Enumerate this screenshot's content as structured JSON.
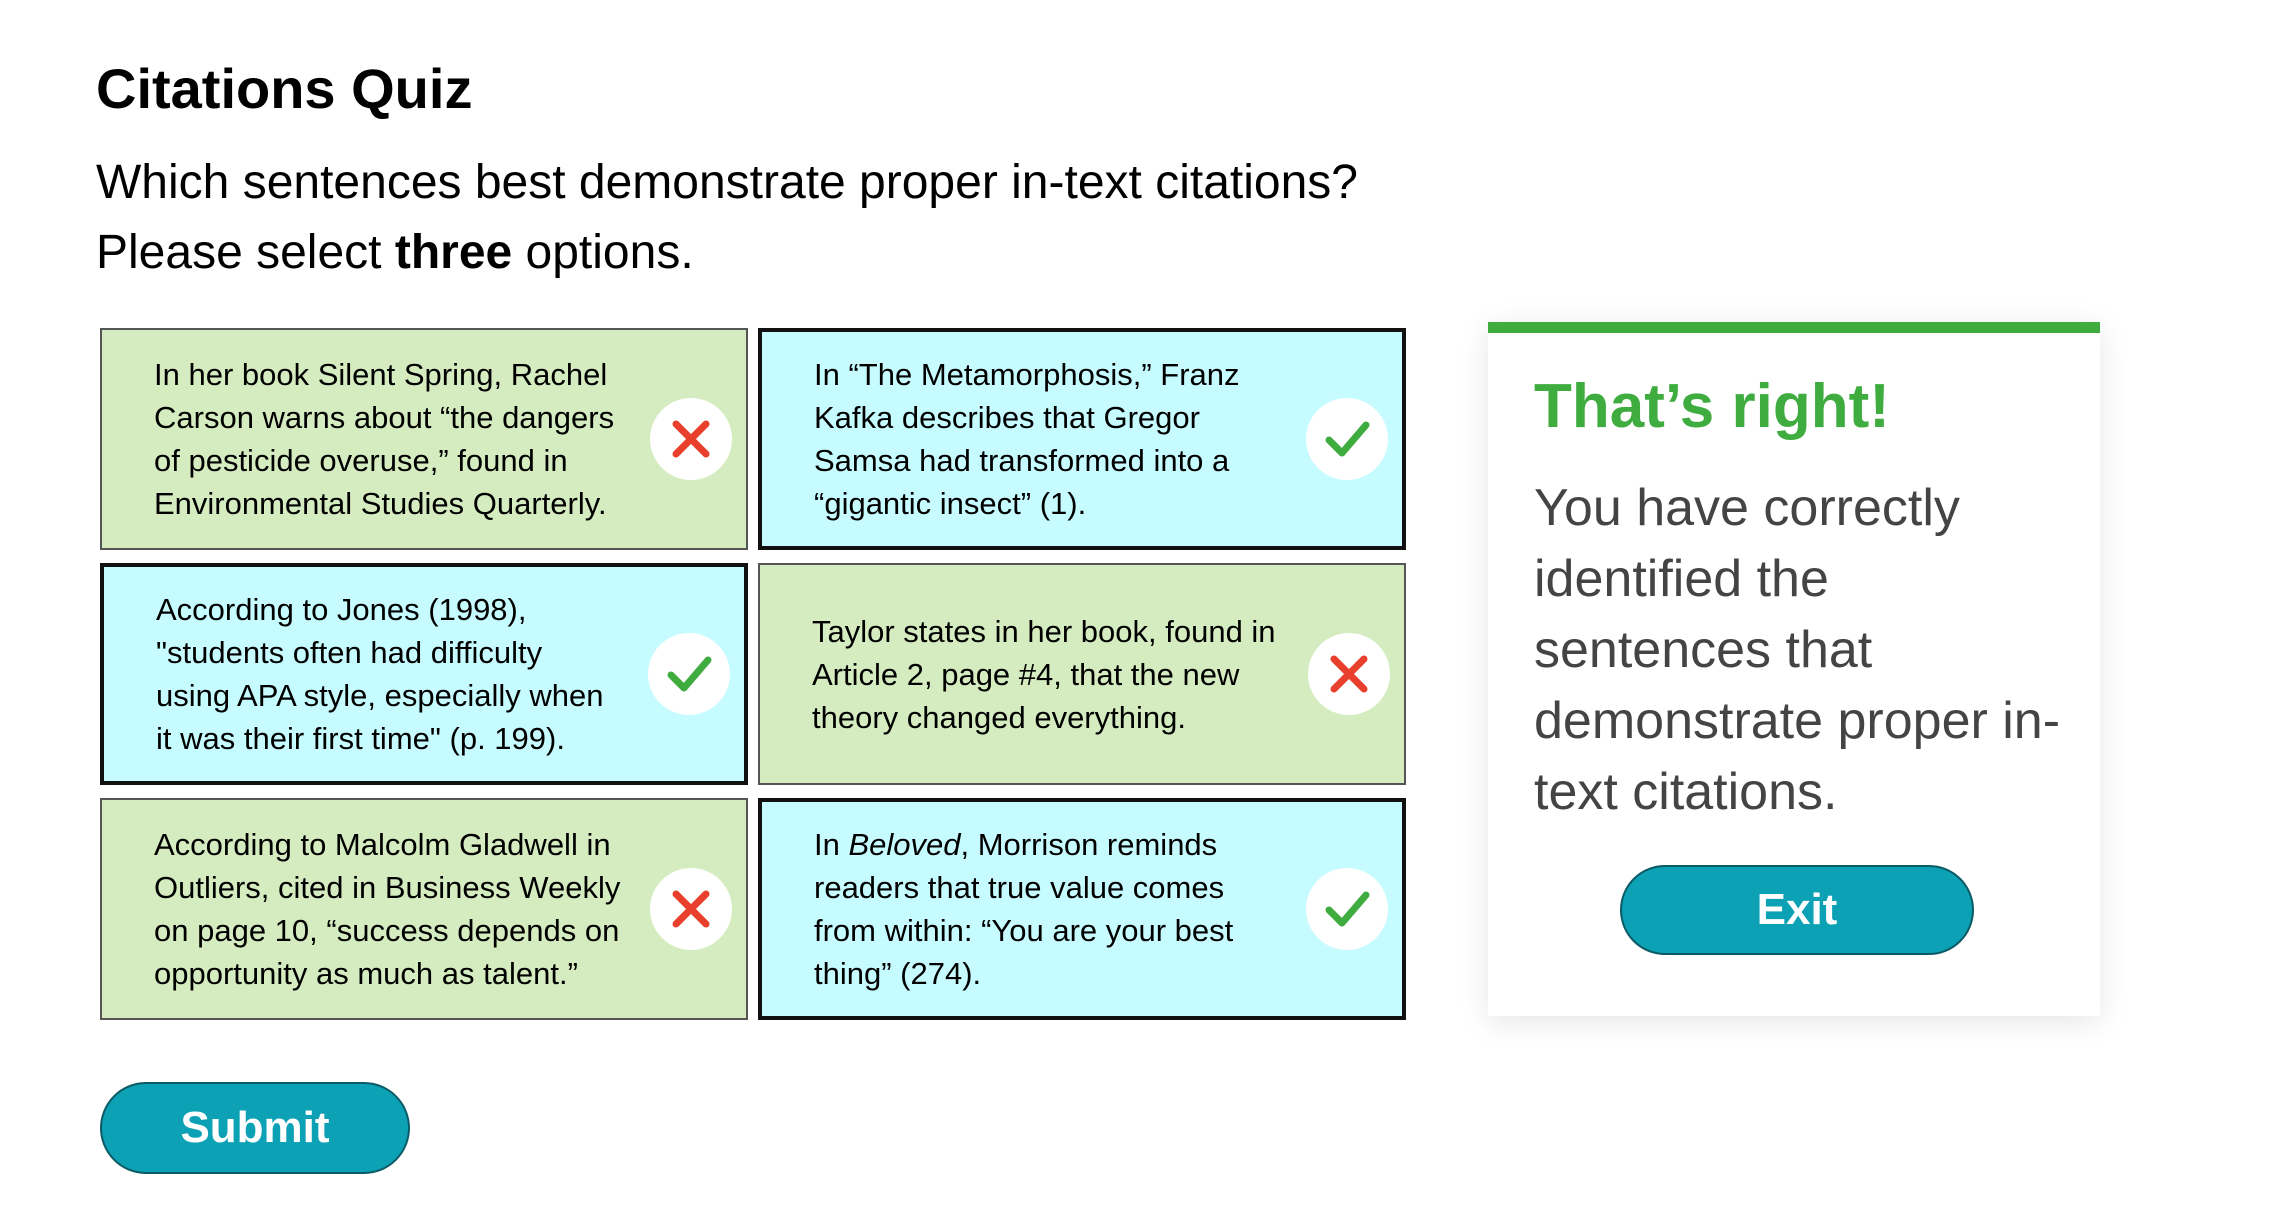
{
  "quiz": {
    "title": "Citations Quiz",
    "prompt_line1": "Which sentences best demonstrate proper in-text citations?",
    "prompt_line2_pre": "Please select ",
    "prompt_line2_bold": "three",
    "prompt_line2_post": " options."
  },
  "options": [
    {
      "text": "In her book Silent Spring, Rachel Carson warns about “the dangers of pesticide overuse,” found in Environmental Studies Quarterly.",
      "result": "incorrect",
      "icon": "x-mark-icon"
    },
    {
      "text": "In “The Metamorphosis,” Franz Kafka describes that Gregor Samsa had transformed into a “gigantic insect” (1).",
      "result": "correct",
      "icon": "checkmark-icon"
    },
    {
      "text": "According to Jones (1998), \"students often had difficulty using APA style, especially when it was their first time\" (p. 199).",
      "result": "correct",
      "icon": "checkmark-icon"
    },
    {
      "text": "Taylor states in her book, found in Article 2, page #4, that the new theory changed everything.",
      "result": "incorrect",
      "icon": "x-mark-icon"
    },
    {
      "text": "According to Malcolm Gladwell in Outliers, cited in Business Weekly on page 10, “success depends on opportunity as much as talent.”",
      "result": "incorrect",
      "icon": "x-mark-icon"
    },
    {
      "text_pre": "In ",
      "text_italic": "Beloved",
      "text_post": ", Morrison reminds readers that true value comes from within: “You are your best thing” (274).",
      "result": "correct",
      "icon": "checkmark-icon"
    }
  ],
  "feedback": {
    "heading": "That’s right!",
    "body": " You have correctly identified the sentences that demonstrate proper in-text citations.",
    "exit_label": "Exit"
  },
  "submit_label": "Submit",
  "colors": {
    "correct_bg": "#c6fbff",
    "incorrect_bg": "#d4ecbf",
    "check_green": "#3fac3f",
    "x_red": "#e8402c",
    "button_teal": "#0ca1b4"
  }
}
